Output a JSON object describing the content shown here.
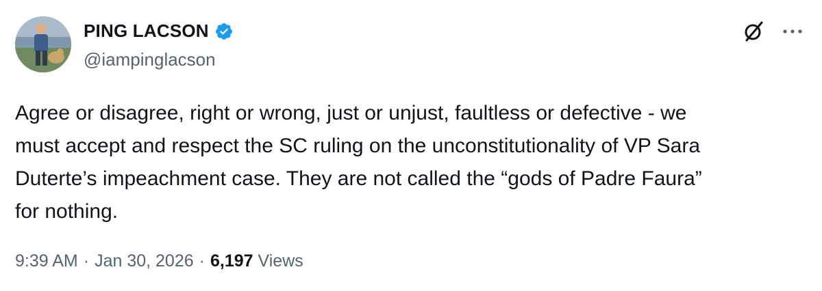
{
  "author": {
    "display_name": "PING LACSON",
    "handle": "@iampinglacson",
    "verified": true,
    "avatar_icon": "profile-photo",
    "verified_icon": "verified-badge-icon",
    "verified_color": "#1d9bf0"
  },
  "header_actions": {
    "grok_icon": "grok-icon",
    "more_icon": "more-options-icon"
  },
  "tweet": {
    "text": "Agree or disagree, right or wrong, just or unjust, faultless or defective - we\nmust accept and respect the SC ruling on the unconstitutionality of VP Sara\nDuterte’s impeachment case. They are not called the “gods of Padre Faura”\nfor nothing.",
    "time": "9:39 AM",
    "separator": "·",
    "date": "Jan 30, 2026",
    "views_count": "6,197",
    "views_label": "Views"
  },
  "colors": {
    "text_primary": "#0f1419",
    "text_secondary": "#536471",
    "background": "#ffffff"
  }
}
